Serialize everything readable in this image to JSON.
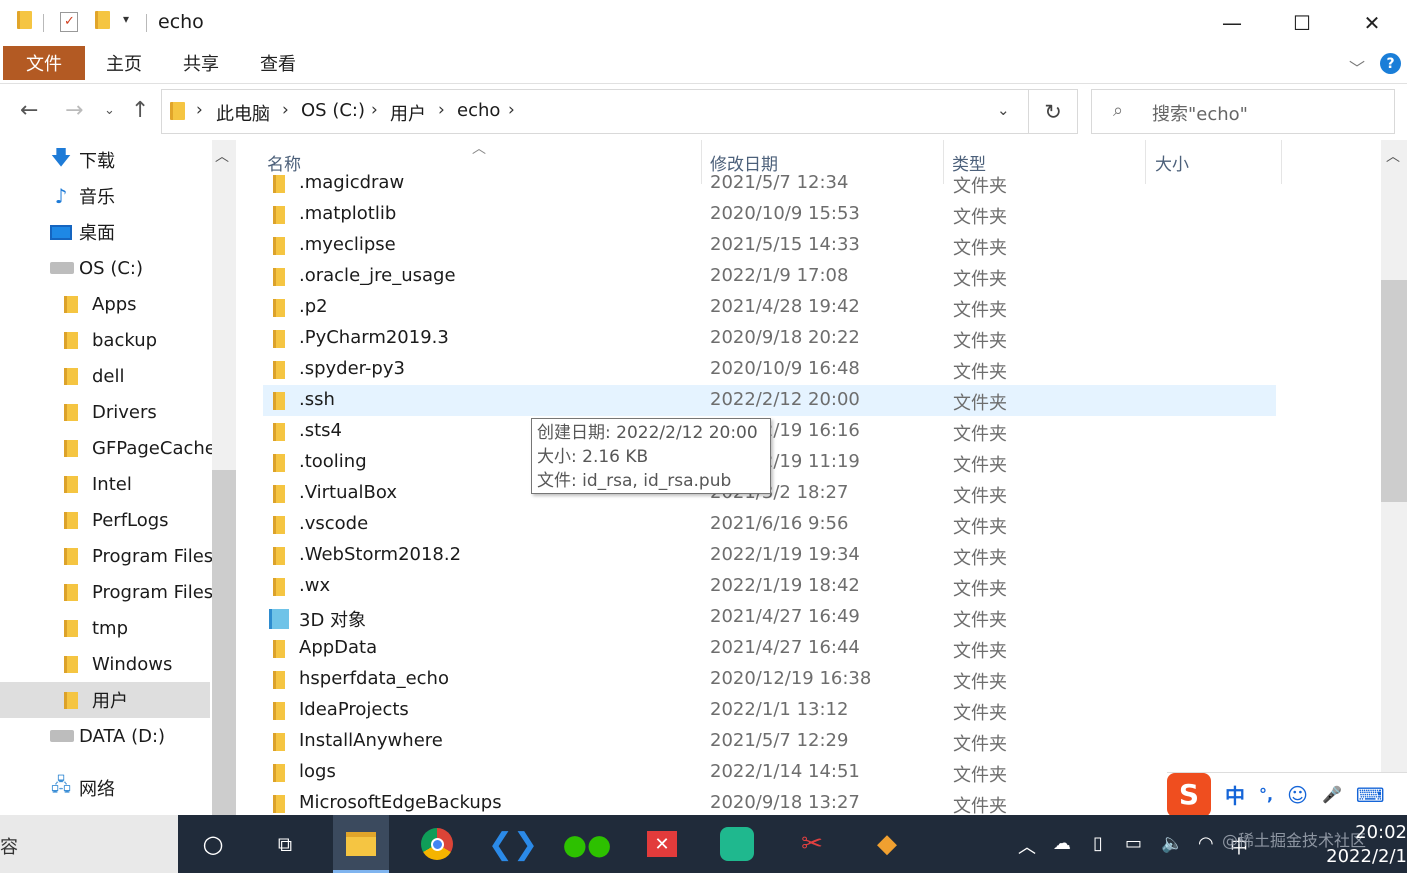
{
  "window": {
    "title": "echo",
    "minimize": "—",
    "maximize": "☐",
    "close": "✕"
  },
  "ribbon": {
    "file": "文件",
    "home": "主页",
    "share": "共享",
    "view": "查看",
    "help": "?"
  },
  "address": {
    "breadcrumbs": [
      "此电脑",
      "OS (C:)",
      "用户",
      "echo"
    ],
    "search_placeholder": "搜索\"echo\""
  },
  "nav": {
    "items": [
      {
        "label": "下载",
        "icon": "download-arrow-icon",
        "level": 0
      },
      {
        "label": "音乐",
        "icon": "music-note-icon",
        "level": 0
      },
      {
        "label": "桌面",
        "icon": "desktop-icon",
        "level": 0
      },
      {
        "label": "OS (C:)",
        "icon": "drive-icon",
        "level": 0
      },
      {
        "label": "Apps",
        "icon": "folder-icon",
        "level": 1
      },
      {
        "label": "backup",
        "icon": "folder-icon",
        "level": 1
      },
      {
        "label": "dell",
        "icon": "folder-icon",
        "level": 1
      },
      {
        "label": "Drivers",
        "icon": "folder-icon",
        "level": 1
      },
      {
        "label": "GFPageCache",
        "icon": "folder-icon",
        "level": 1
      },
      {
        "label": "Intel",
        "icon": "folder-icon",
        "level": 1
      },
      {
        "label": "PerfLogs",
        "icon": "folder-icon",
        "level": 1
      },
      {
        "label": "Program Files",
        "icon": "folder-icon",
        "level": 1
      },
      {
        "label": "Program Files",
        "icon": "folder-icon",
        "level": 1
      },
      {
        "label": "tmp",
        "icon": "folder-icon",
        "level": 1
      },
      {
        "label": "Windows",
        "icon": "folder-icon",
        "level": 1
      },
      {
        "label": "用户",
        "icon": "folder-icon",
        "level": 1,
        "selected": true
      },
      {
        "label": "DATA (D:)",
        "icon": "drive-icon",
        "level": 0
      },
      {
        "label": "网络",
        "icon": "network-icon",
        "level": 0
      }
    ]
  },
  "list": {
    "headers": {
      "name": "名称",
      "modified": "修改日期",
      "type": "类型",
      "size": "大小"
    },
    "rows": [
      {
        "name": ".magicdraw",
        "date": "2021/5/7 12:34",
        "type": "文件夹"
      },
      {
        "name": ".matplotlib",
        "date": "2020/10/9 15:53",
        "type": "文件夹"
      },
      {
        "name": ".myeclipse",
        "date": "2021/5/15 14:33",
        "type": "文件夹"
      },
      {
        "name": ".oracle_jre_usage",
        "date": "2022/1/9 17:08",
        "type": "文件夹"
      },
      {
        "name": ".p2",
        "date": "2021/4/28 19:42",
        "type": "文件夹"
      },
      {
        "name": ".PyCharm2019.3",
        "date": "2020/9/18 20:22",
        "type": "文件夹"
      },
      {
        "name": ".spyder-py3",
        "date": "2020/10/9 16:48",
        "type": "文件夹"
      },
      {
        "name": ".ssh",
        "date": "2022/2/12 20:00",
        "type": "文件夹",
        "selected": true
      },
      {
        "name": ".sts4",
        "date": "2022/2/19 16:16",
        "type": "文件夹"
      },
      {
        "name": ".tooling",
        "date": "2022/2/19 11:19",
        "type": "文件夹"
      },
      {
        "name": ".VirtualBox",
        "date": "2021/3/2 18:27",
        "type": "文件夹"
      },
      {
        "name": ".vscode",
        "date": "2021/6/16 9:56",
        "type": "文件夹"
      },
      {
        "name": ".WebStorm2018.2",
        "date": "2022/1/19 19:34",
        "type": "文件夹"
      },
      {
        "name": ".wx",
        "date": "2022/1/19 18:42",
        "type": "文件夹"
      },
      {
        "name": "3D 对象",
        "date": "2021/4/27 16:49",
        "type": "文件夹",
        "icon": "3d-objects-icon"
      },
      {
        "name": "AppData",
        "date": "2021/4/27 16:44",
        "type": "文件夹"
      },
      {
        "name": "hsperfdata_echo",
        "date": "2020/12/19 16:38",
        "type": "文件夹"
      },
      {
        "name": "IdeaProjects",
        "date": "2022/1/1 13:12",
        "type": "文件夹"
      },
      {
        "name": "InstallAnywhere",
        "date": "2021/5/7 12:29",
        "type": "文件夹"
      },
      {
        "name": "logs",
        "date": "2022/1/14 14:51",
        "type": "文件夹"
      },
      {
        "name": "MicrosoftEdgeBackups",
        "date": "2020/9/18 13:27",
        "type": "文件夹"
      }
    ]
  },
  "tooltip": {
    "created": "创建日期: 2022/2/12 20:00",
    "size": "大小: 2.16 KB",
    "files": "文件: id_rsa, id_rsa.pub"
  },
  "ime": {
    "logo": "S",
    "lang": "中",
    "punct": "°,",
    "emoji": "☺",
    "mic": "🎤",
    "keyboard": "⌨"
  },
  "taskbar": {
    "left_fragment": "容",
    "watermark": "@稀土掘金技术社区",
    "time": "20:02",
    "date": "2022/2/1"
  },
  "colors": {
    "accent_file_tab": "#b35a23",
    "selection": "#e5f3ff",
    "taskbar": "#202b3a",
    "folder": "#f5c542"
  }
}
